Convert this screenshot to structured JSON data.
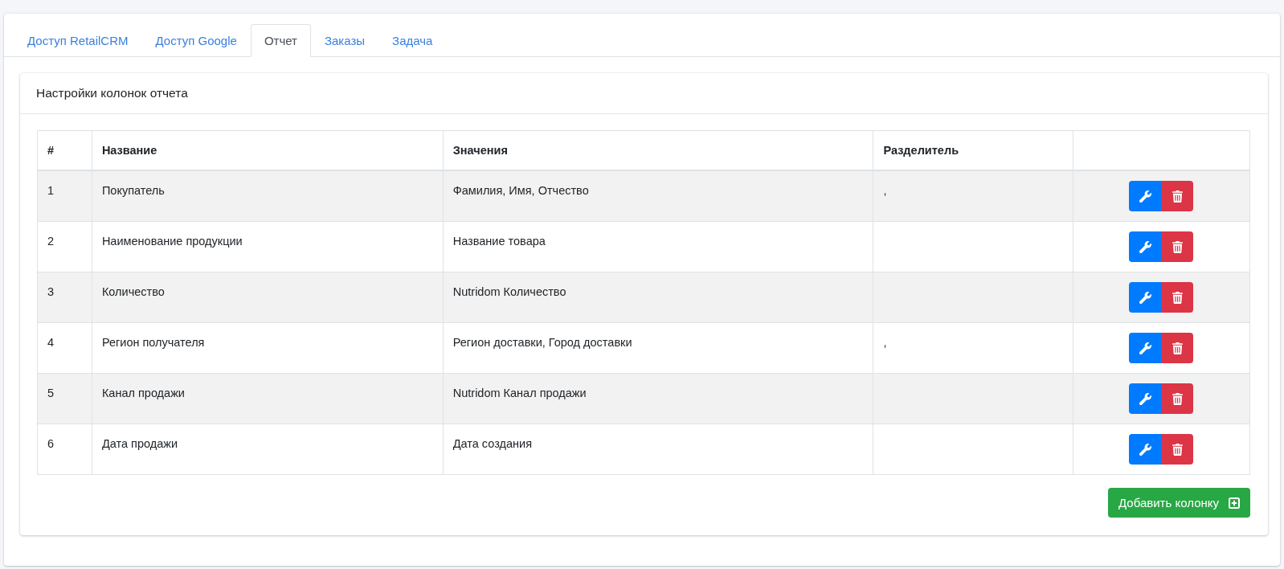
{
  "tabs": [
    {
      "label": "Доступ RetailCRM",
      "selected": false
    },
    {
      "label": "Доступ Google",
      "selected": false
    },
    {
      "label": "Отчет",
      "selected": true
    },
    {
      "label": "Заказы",
      "selected": false
    },
    {
      "label": "Задача",
      "selected": false
    }
  ],
  "card": {
    "title": "Настройки колонок отчета"
  },
  "table": {
    "columns": [
      "#",
      "Название",
      "Значения",
      "Разделитель"
    ],
    "rows": [
      {
        "number": "1",
        "name": "Покупатель",
        "values": "Фамилия, Имя, Отчество",
        "separator": ","
      },
      {
        "number": "2",
        "name": "Наименование продукции",
        "values": "Название товара"
      },
      {
        "number": "3",
        "name": "Количество",
        "values": "Nutridom Количество"
      },
      {
        "number": "4",
        "name": "Регион получателя",
        "values": "Регион доставки, Город доставки",
        "separator": ","
      },
      {
        "number": "5",
        "name": "Канал продажи",
        "values": "Nutridom Канал продажи"
      },
      {
        "number": "6",
        "name": "Дата продажи",
        "values": "Дата создания"
      }
    ]
  },
  "add_button": {
    "label": "Добавить колонку"
  }
}
